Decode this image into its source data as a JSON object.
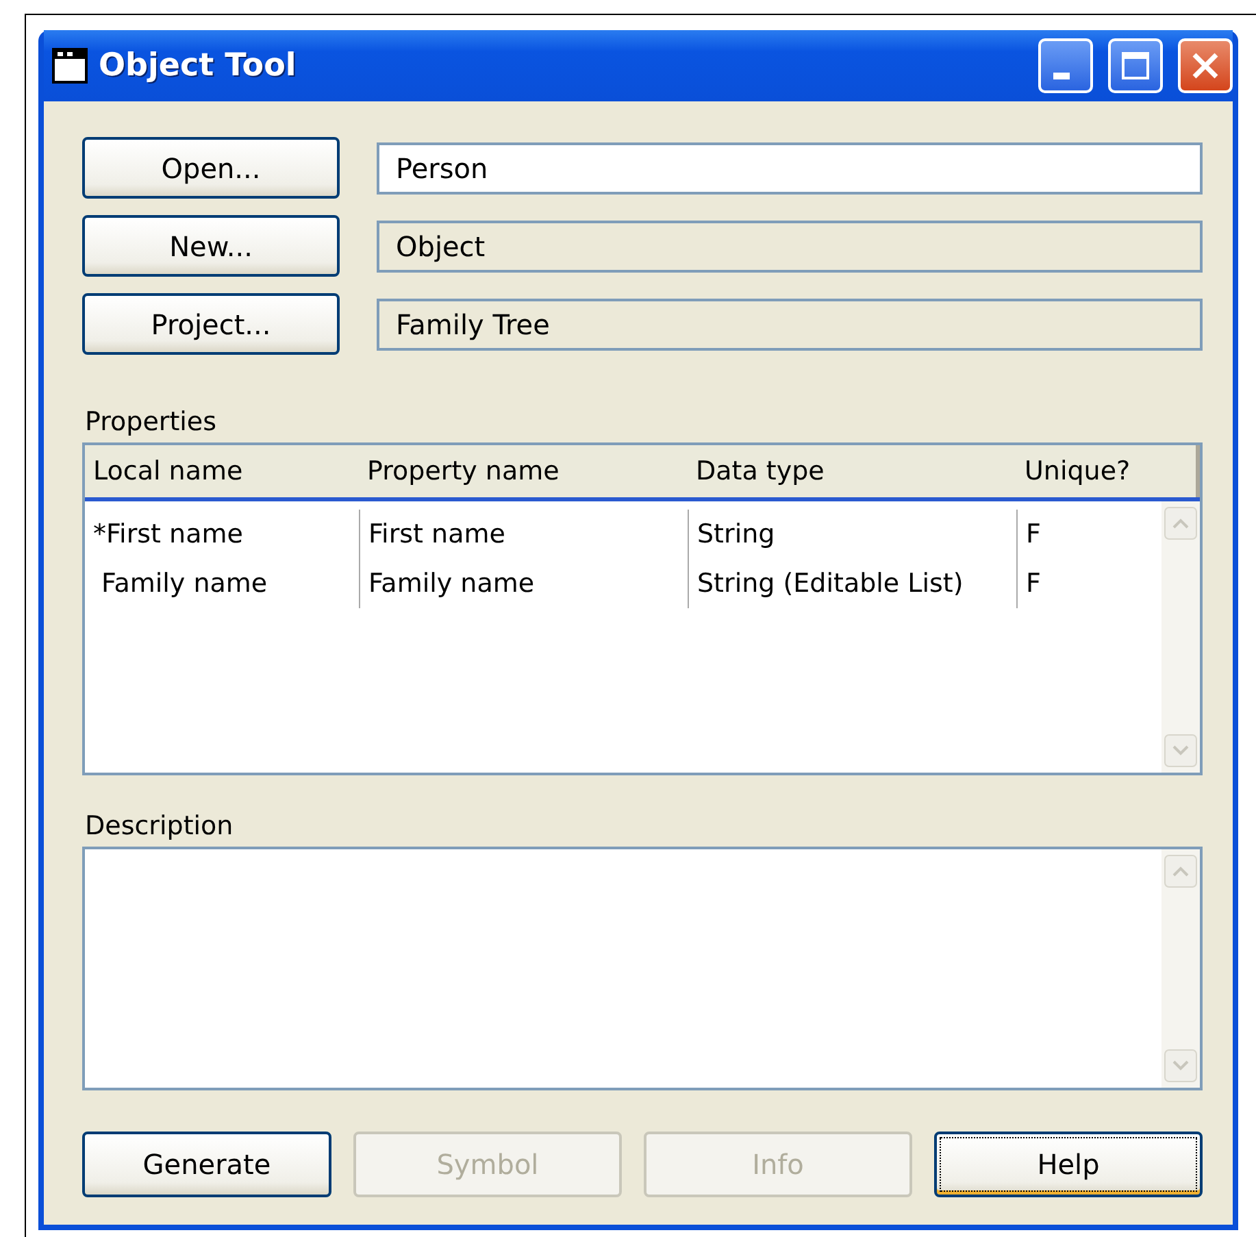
{
  "window": {
    "title": "Object Tool"
  },
  "fields": [
    {
      "button": "Open...",
      "value": "Person",
      "readonly": false
    },
    {
      "button": "New...",
      "value": "Object",
      "readonly": true
    },
    {
      "button": "Project...",
      "value": "Family Tree",
      "readonly": true
    }
  ],
  "properties": {
    "label": "Properties",
    "columns": [
      "Local name",
      "Property name",
      "Data type",
      "Unique?"
    ],
    "rows": [
      [
        "*First name",
        "First name",
        "String",
        "F"
      ],
      [
        " Family name",
        "Family name",
        "String (Editable List)",
        "F"
      ]
    ]
  },
  "description": {
    "label": "Description"
  },
  "buttons": [
    {
      "label": "Generate",
      "disabled": false,
      "focused": false
    },
    {
      "label": "Symbol",
      "disabled": true,
      "focused": false
    },
    {
      "label": "Info",
      "disabled": true,
      "focused": false
    },
    {
      "label": "Help",
      "disabled": false,
      "focused": true
    }
  ]
}
